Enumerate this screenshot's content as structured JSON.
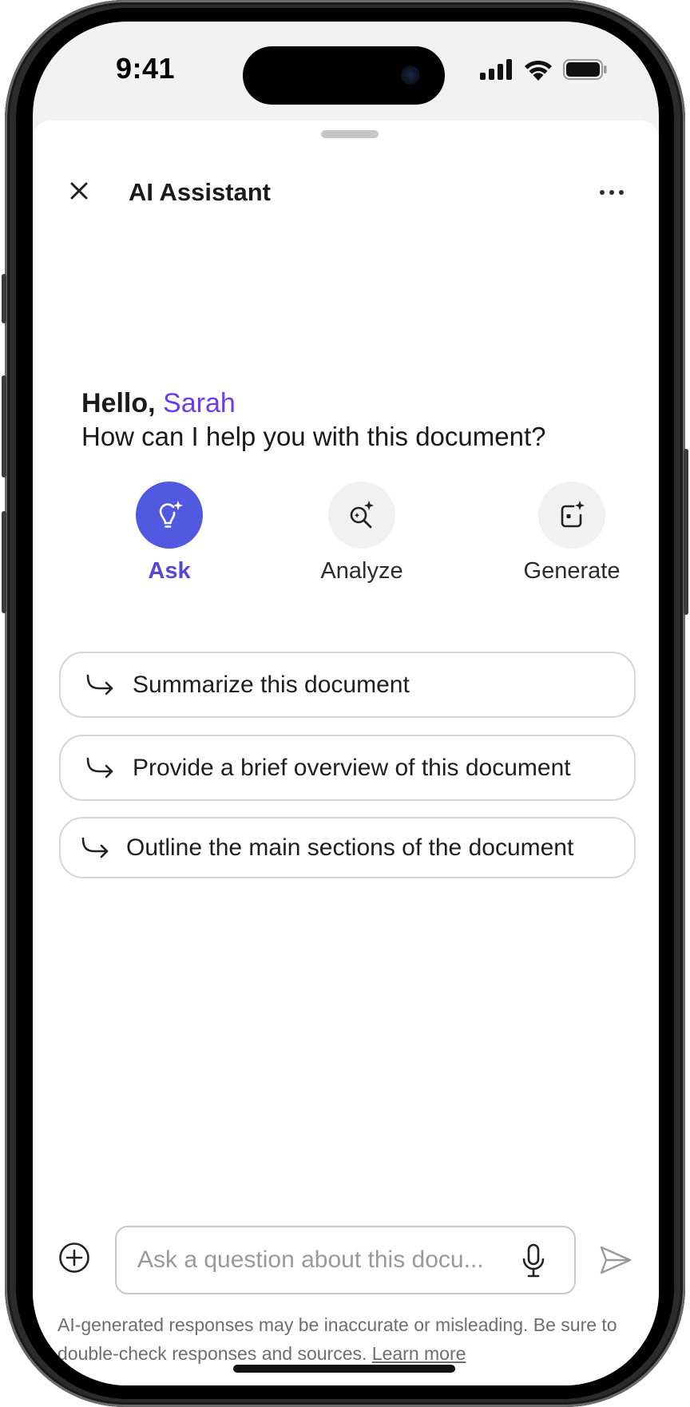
{
  "status_bar": {
    "time": "9:41"
  },
  "header": {
    "title": "AI Assistant"
  },
  "greeting": {
    "hello": "Hello,",
    "name": "Sarah",
    "question": "How can I help you with this document?"
  },
  "modes": [
    {
      "label": "Ask",
      "icon": "lightbulb-sparkle-icon",
      "active": true
    },
    {
      "label": "Analyze",
      "icon": "magnify-sparkle-icon",
      "active": false
    },
    {
      "label": "Generate",
      "icon": "square-sparkle-icon",
      "active": false
    }
  ],
  "suggestions": [
    "Summarize this document",
    "Provide a brief overview of this document",
    "Outline the main sections of the document"
  ],
  "input": {
    "placeholder": "Ask a question about this docu...",
    "value": ""
  },
  "disclaimer": {
    "text": "AI-generated responses may be inaccurate or misleading. Be sure to double-check responses and sources.",
    "link": "Learn more"
  },
  "colors": {
    "accent": "#5159e0",
    "accent_text": "#5945d6",
    "name_color": "#6b3cf0"
  }
}
